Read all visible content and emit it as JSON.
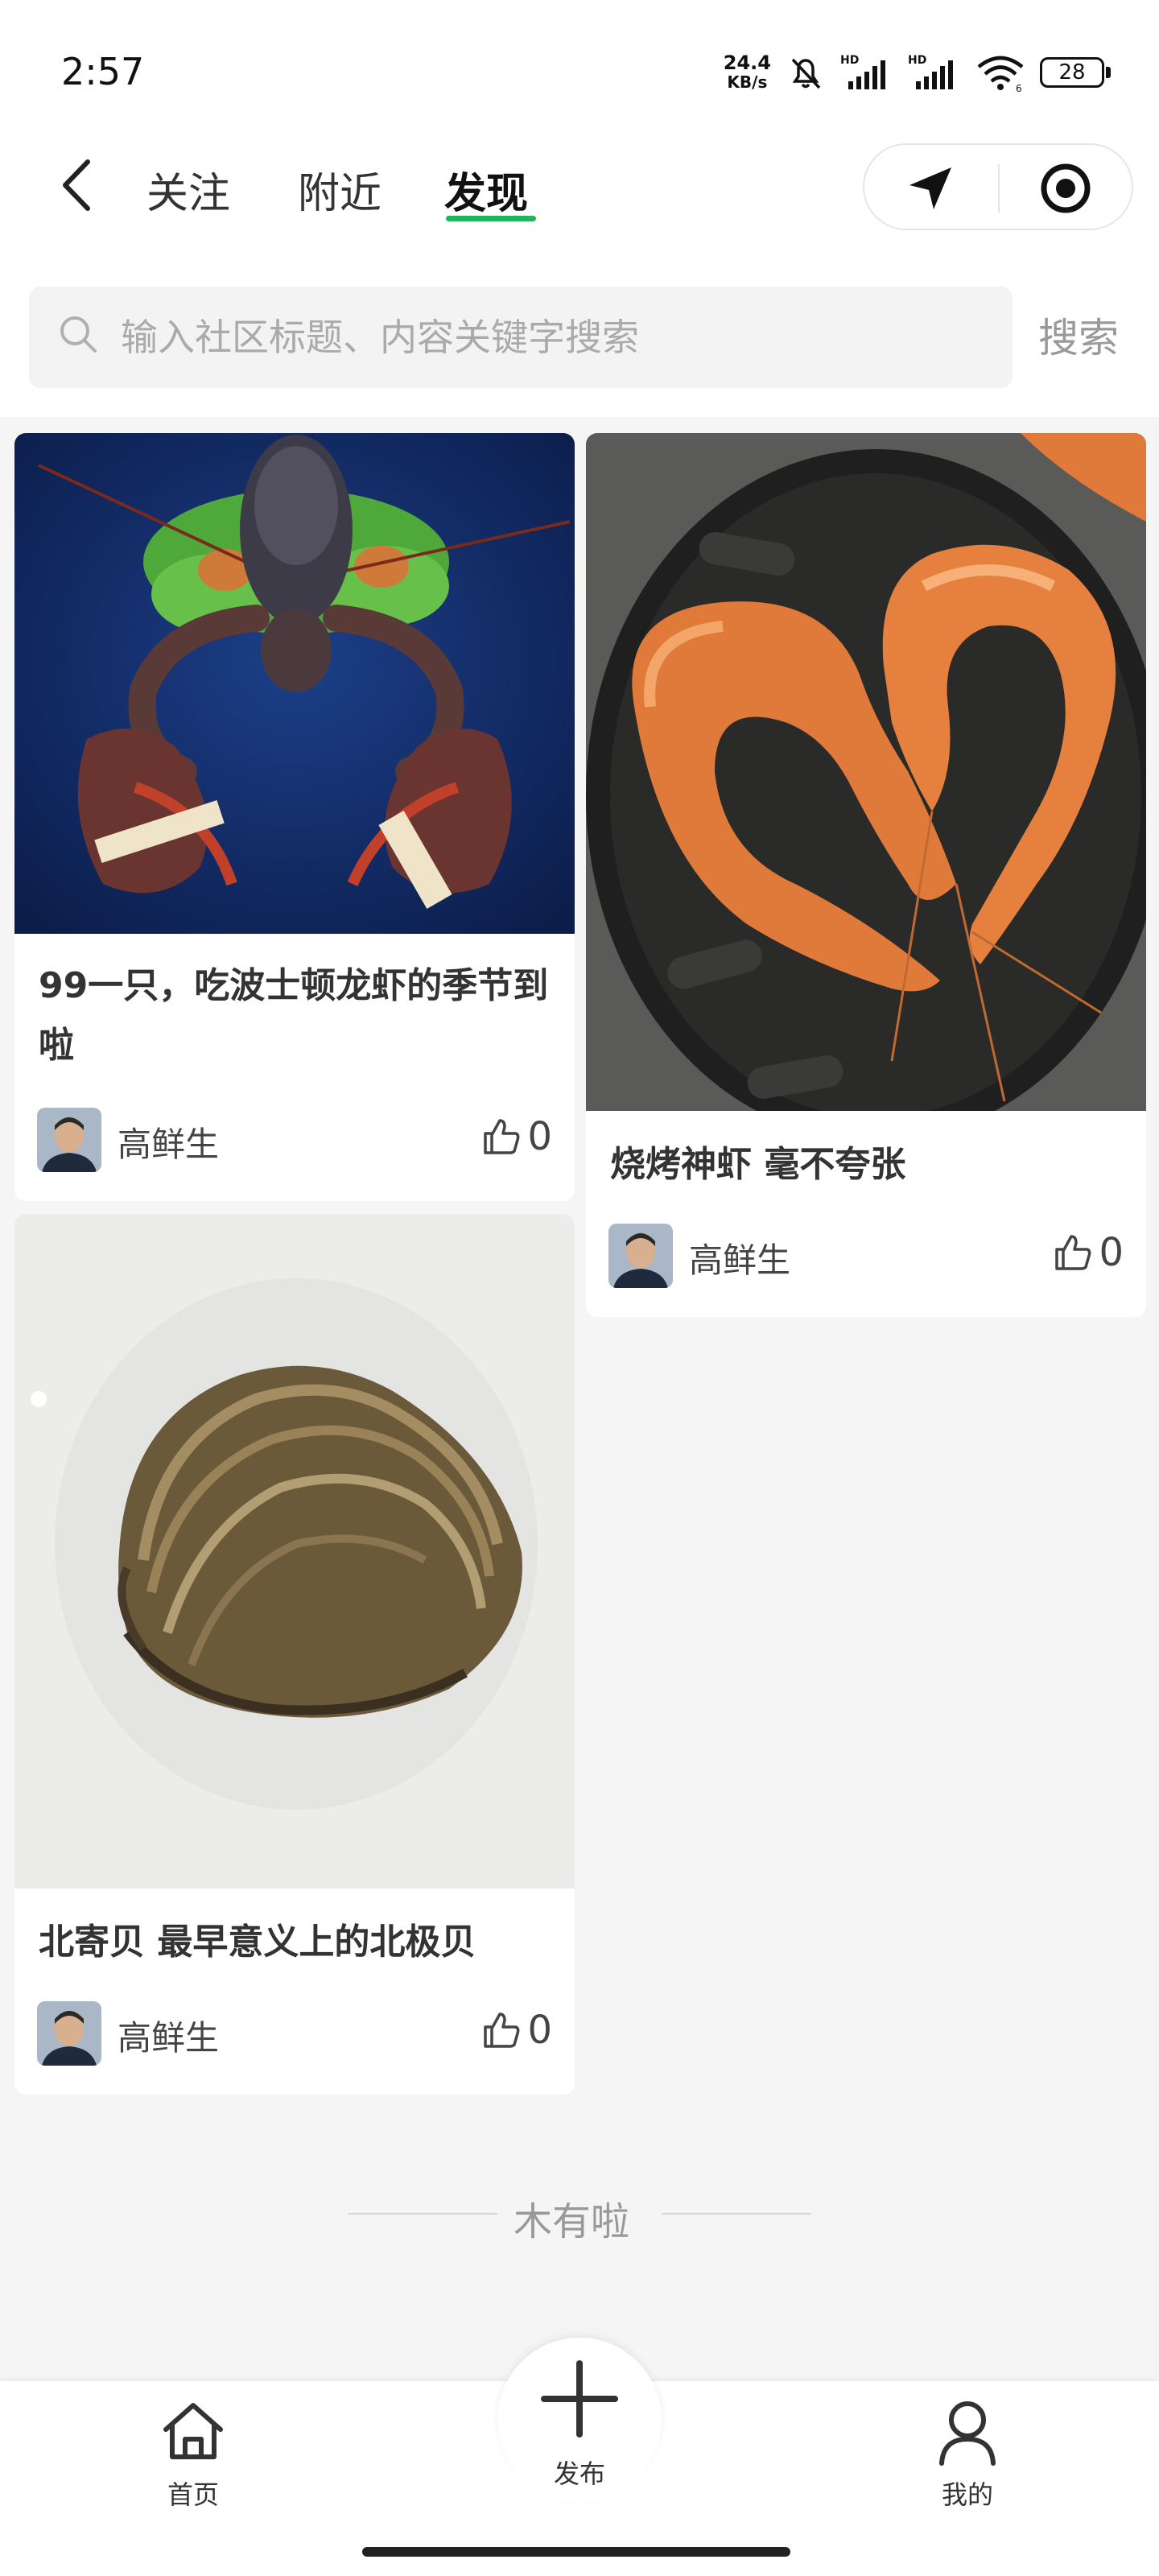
{
  "status_bar": {
    "time": "2:57",
    "net_speed_value": "24.4",
    "net_speed_unit": "KB/s",
    "battery": "28"
  },
  "header": {
    "tabs": [
      {
        "label": "关注",
        "active": false
      },
      {
        "label": "附近",
        "active": false
      },
      {
        "label": "发现",
        "active": true
      }
    ],
    "accent_color": "#22b45c"
  },
  "search": {
    "placeholder": "输入社区标题、内容关键字搜索",
    "value": "",
    "button_label": "搜索"
  },
  "feed": [
    {
      "title": "99一只，吃波士顿龙虾的季节到啦",
      "author": "高鲜生",
      "likes": "0",
      "image": "lobster-photo"
    },
    {
      "title": "烧烤神虾 毫不夸张",
      "author": "高鲜生",
      "likes": "0",
      "image": "grilled-shrimp-photo"
    },
    {
      "title": "北寄贝 最早意义上的北极贝",
      "author": "高鲜生",
      "likes": "0",
      "image": "clam-photo"
    }
  ],
  "end_text": "木有啦",
  "bottom_nav": {
    "items": [
      {
        "label": "首页",
        "icon": "home-icon"
      },
      {
        "label": "发布",
        "icon": "plus-icon"
      },
      {
        "label": "我的",
        "icon": "person-icon"
      }
    ]
  }
}
